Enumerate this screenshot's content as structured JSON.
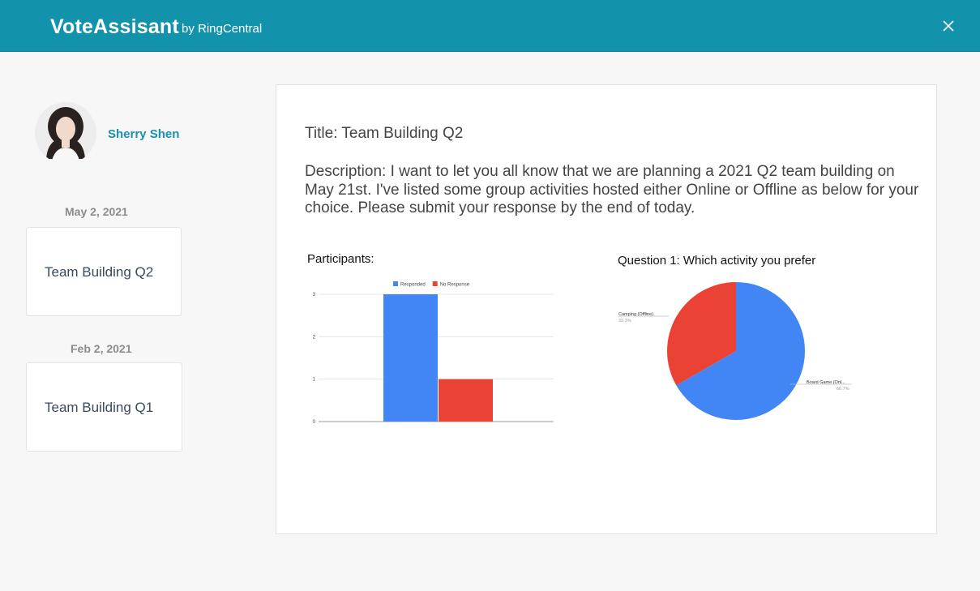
{
  "header": {
    "app_name": "VoteAssisant",
    "byline": "by RingCentral",
    "close_icon": "close-icon",
    "color": "#1393ab"
  },
  "user": {
    "name": "Sherry Shen",
    "avatar_icon": "avatar"
  },
  "polls": [
    {
      "date": "May 2, 2021",
      "title": "Team Building Q2"
    },
    {
      "date": "Feb 2, 2021",
      "title": "Team Building Q1"
    }
  ],
  "detail": {
    "title_text": "Title: Team Building Q2",
    "description_text": "Description: I want to let you all know that we are planning a 2021 Q2 team building on May 21st. I've listed some group activities hosted either Online or Offline as below for your choice. Please submit your response by the end of today."
  },
  "chart_data": [
    {
      "type": "bar",
      "title": "Participants:",
      "categories": [
        ""
      ],
      "series": [
        {
          "name": "Responded",
          "values": [
            3
          ],
          "color": "#4285f4"
        },
        {
          "name": "No Response",
          "values": [
            1
          ],
          "color": "#ea4335"
        }
      ],
      "ylim": [
        0,
        3
      ],
      "yticks": [
        "0",
        "1",
        "2",
        "3"
      ],
      "legend": "top",
      "grid": true
    },
    {
      "type": "pie",
      "title": "Question 1: Which activity you prefer",
      "slices": [
        {
          "label": "Board Game (Onl...",
          "value": 66.7,
          "pct_label": "66.7%",
          "color": "#4285f4"
        },
        {
          "label": "Camping (Offline)",
          "value": 33.3,
          "pct_label": "33.3%",
          "color": "#ea4335"
        }
      ]
    }
  ]
}
